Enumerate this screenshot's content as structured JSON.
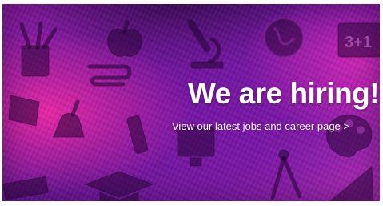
{
  "banner": {
    "headline": "We are hiring!",
    "link_text": "View our latest jobs and career page >",
    "colors": {
      "background_primary": "#6a1597",
      "background_accent": "#ff28aa",
      "text": "#ffffff"
    },
    "decorative_icons": [
      "pencil-cup-icon",
      "apple-icon",
      "microscope-icon",
      "globe-icon",
      "chalkboard-icon",
      "paperclip-icon",
      "book-icon",
      "bell-icon",
      "glue-stick-icon",
      "computer-monitor-icon",
      "paint-palette-icon",
      "drafting-compass-icon",
      "set-square-icon",
      "graduation-cap-icon",
      "ruler-icon"
    ],
    "chalkboard_text": "3+1"
  }
}
